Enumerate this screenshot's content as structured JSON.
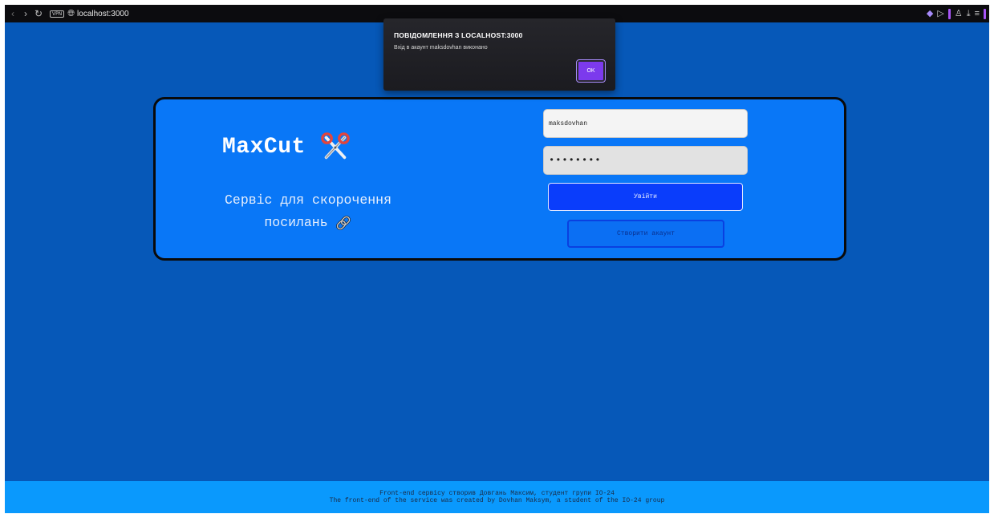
{
  "browser": {
    "vpn_badge": "VPN",
    "url": "localhost:3000",
    "icons": [
      "back-icon",
      "forward-icon",
      "reload-icon",
      "globe-icon",
      "shield-icon",
      "play-icon",
      "profile-icon",
      "download-icon",
      "menu-icon"
    ]
  },
  "dialog": {
    "title": "ПОВІДОМЛЕННЯ З LOCALHOST:3000",
    "message": "Вхід в акаунт maksdovhan виконано",
    "ok_label": "OK"
  },
  "brand": {
    "name": "MaxCut",
    "tagline_line1": "Сервіс для скорочення",
    "tagline_line2": "посилань"
  },
  "login": {
    "username_value": "maksdovhan",
    "password_value": "••••••••",
    "login_label": "Увійти",
    "create_label": "Створити акаунт"
  },
  "footer": {
    "line_ua": "Front-end сервісу створив Довгань Максим, студент групи ІО-24",
    "line_en": "The front-end of the service was created by Dovhan Maksym, a student of the IO-24 group"
  },
  "colors": {
    "page_bg": "#0658b8",
    "card_bg": "#0977f7",
    "login_button": "#0a3dfb",
    "footer_bg": "#0a99fd",
    "dialog_button": "#7c3aed"
  }
}
